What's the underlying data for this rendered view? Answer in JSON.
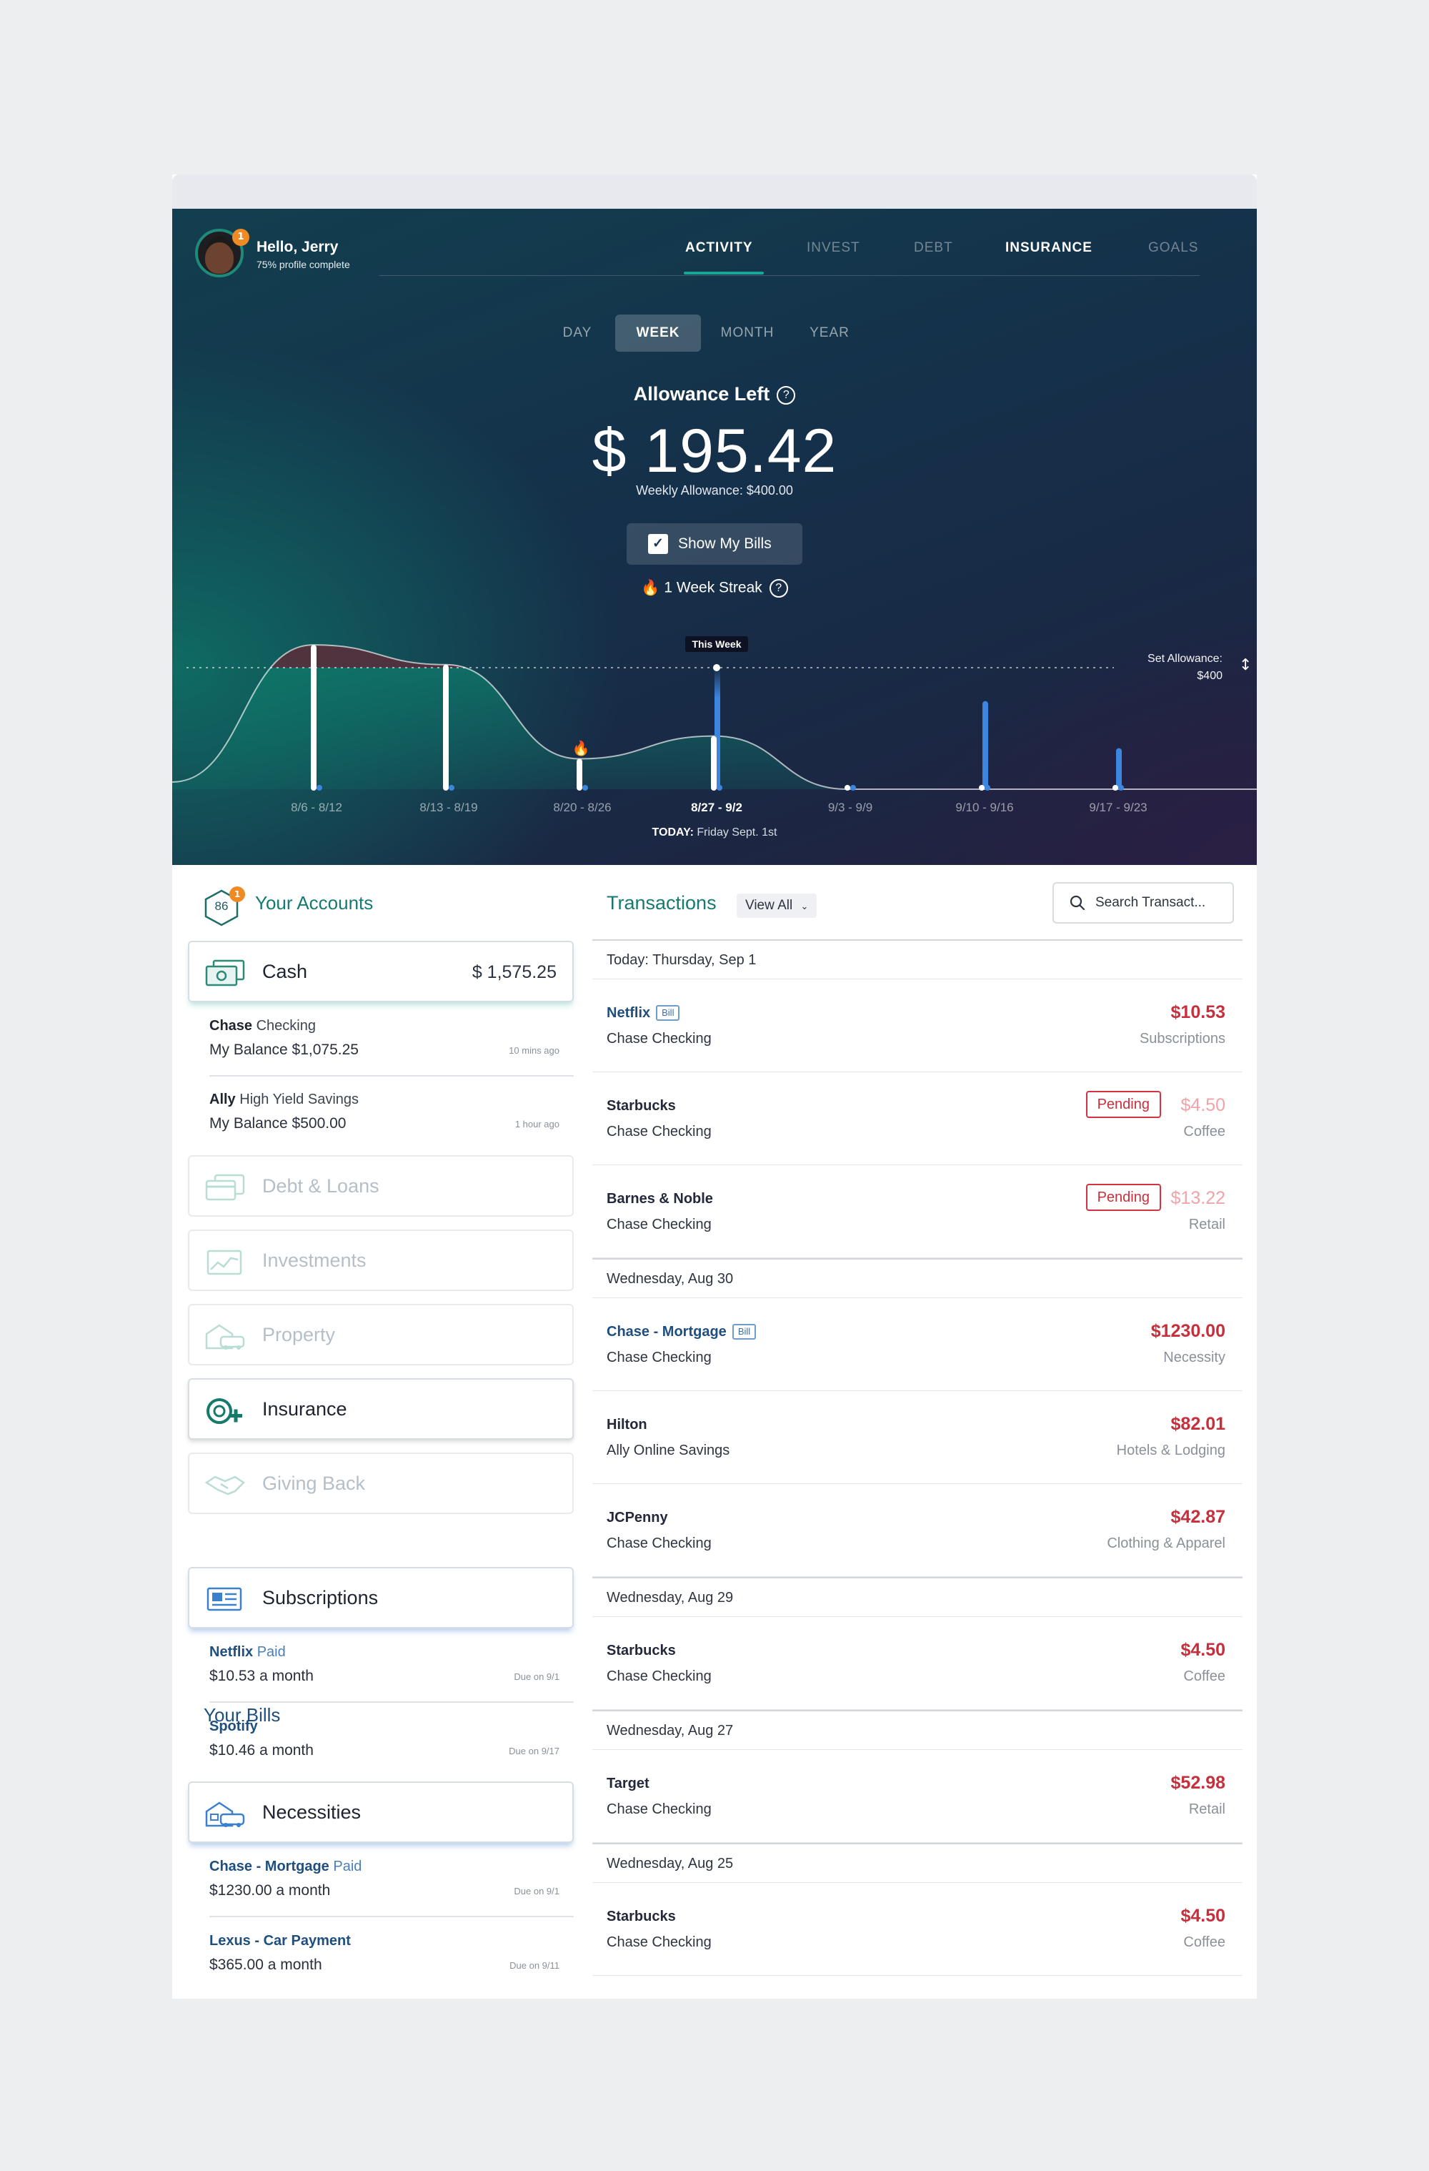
{
  "user": {
    "greeting": "Hello, Jerry",
    "profile_status": "75% profile complete",
    "notification_count": "1"
  },
  "nav": {
    "tabs": [
      "ACTIVITY",
      "INVEST",
      "DEBT",
      "INSURANCE",
      "GOALS"
    ],
    "active": "ACTIVITY"
  },
  "periods": {
    "options": [
      "DAY",
      "WEEK",
      "MONTH",
      "YEAR"
    ],
    "active": "WEEK"
  },
  "allowance": {
    "title": "Allowance Left",
    "help": "?",
    "amount": "$ 195.42",
    "weekly": "Weekly Allowance: $400.00",
    "show_bills_label": "Show My Bills",
    "show_bills_checked": true,
    "streak_label": "1 Week Streak",
    "set_allowance_line1": "Set Allowance:",
    "set_allowance_line2": "$400",
    "this_week_label": "This Week",
    "today_prefix": "TODAY:",
    "today_value": "Friday Sept. 1st"
  },
  "chart_data": {
    "type": "bar",
    "categories": [
      "8/6 - 8/12",
      "8/13 - 8/19",
      "8/20 - 8/26",
      "8/27 - 9/2",
      "9/3 - 9/9",
      "9/10 - 9/16",
      "9/17 - 9/23"
    ],
    "current_category": "8/27 - 9/2",
    "allowance_line": 400,
    "series": [
      {
        "values": [
          475,
          410,
          100,
          175,
          0,
          0,
          0
        ]
      },
      {
        "values": [
          0,
          0,
          0,
          400,
          0,
          290,
          135
        ]
      }
    ],
    "streak_marker_category": "8/20 - 8/26",
    "colors": {
      "spent": "#ffffff",
      "bills": "#3d86e0",
      "over": "#5a2e3a",
      "under": "#0e7a6b"
    }
  },
  "accounts": {
    "score": "86",
    "score_badge": "1",
    "title": "Your Accounts",
    "cash": {
      "label": "Cash",
      "amount": "$ 1,575.25"
    },
    "cash_items": [
      {
        "bank": "Chase",
        "type": "Checking",
        "balance": "My Balance $1,075.25",
        "time": "10 mins ago"
      },
      {
        "bank": "Ally",
        "type": "High Yield Savings",
        "balance": "My Balance $500.00",
        "time": "1 hour ago"
      }
    ],
    "categories": [
      {
        "label": "Debt & Loans",
        "icon": "credit-cards-icon"
      },
      {
        "label": "Investments",
        "icon": "line-chart-icon"
      },
      {
        "label": "Property",
        "icon": "house-car-icon"
      },
      {
        "label": "Insurance",
        "icon": "lifebuoy-icon"
      },
      {
        "label": "Giving Back",
        "icon": "handshake-icon"
      }
    ]
  },
  "bills": {
    "title": "Your Bills",
    "subscriptions": {
      "label": "Subscriptions",
      "items": [
        {
          "name": "Netflix",
          "status": "Paid",
          "amount": "$10.53 a month",
          "due": "Due on 9/1"
        },
        {
          "name": "Spotify",
          "status": "",
          "amount": "$10.46 a month",
          "due": "Due on 9/17"
        }
      ]
    },
    "necessities": {
      "label": "Necessities",
      "items": [
        {
          "name": "Chase - Mortgage",
          "status": "Paid",
          "amount": "$1230.00 a month",
          "due": "Due on 9/1"
        },
        {
          "name": "Lexus - Car Payment",
          "status": "",
          "amount": "$365.00 a month",
          "due": "Due on 9/11"
        }
      ]
    }
  },
  "transactions": {
    "title": "Transactions",
    "view_all": "View All",
    "search_placeholder": "Search Transact...",
    "bill_tag": "Bill",
    "pending_tag": "Pending",
    "groups": [
      {
        "date": "Today: Thursday, Sep 1",
        "items": [
          {
            "merchant": "Netflix",
            "bill": true,
            "pending": false,
            "account": "Chase Checking",
            "amount": "$10.53",
            "category": "Subscriptions"
          },
          {
            "merchant": "Starbucks",
            "bill": false,
            "pending": true,
            "account": "Chase Checking",
            "amount": "$4.50",
            "category": "Coffee"
          },
          {
            "merchant": "Barnes & Noble",
            "bill": false,
            "pending": true,
            "account": "Chase Checking",
            "amount": "$13.22",
            "category": "Retail"
          }
        ]
      },
      {
        "date": "Wednesday, Aug 30",
        "items": [
          {
            "merchant": "Chase - Mortgage",
            "bill": true,
            "pending": false,
            "account": "Chase Checking",
            "amount": "$1230.00",
            "category": "Necessity"
          },
          {
            "merchant": "Hilton",
            "bill": false,
            "pending": false,
            "account": "Ally Online Savings",
            "amount": "$82.01",
            "category": "Hotels & Lodging"
          },
          {
            "merchant": "JCPenny",
            "bill": false,
            "pending": false,
            "account": "Chase Checking",
            "amount": "$42.87",
            "category": "Clothing & Apparel"
          }
        ]
      },
      {
        "date": "Wednesday, Aug 29",
        "items": [
          {
            "merchant": "Starbucks",
            "bill": false,
            "pending": false,
            "account": "Chase Checking",
            "amount": "$4.50",
            "category": "Coffee"
          }
        ]
      },
      {
        "date": "Wednesday, Aug 27",
        "items": [
          {
            "merchant": "Target",
            "bill": false,
            "pending": false,
            "account": "Chase Checking",
            "amount": "$52.98",
            "category": "Retail"
          }
        ]
      },
      {
        "date": "Wednesday, Aug 25",
        "items": [
          {
            "merchant": "Starbucks",
            "bill": false,
            "pending": false,
            "account": "Chase Checking",
            "amount": "$4.50",
            "category": "Coffee"
          }
        ]
      }
    ]
  }
}
